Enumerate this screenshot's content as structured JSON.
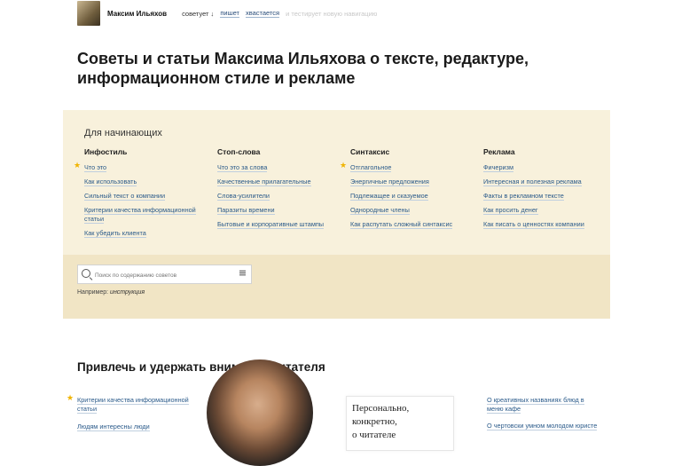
{
  "header": {
    "author": "Максим Ильяхов",
    "nav": {
      "advises": "советует ↓",
      "writes": "пишет",
      "boasts": "хвастается",
      "tests": "и тестирует новую навигацию"
    }
  },
  "page_title": "Советы и статьи Максима Ильяхова о тексте, редактуре, информационном стиле и рекламе",
  "beginners": {
    "heading": "Для начинающих",
    "columns": [
      {
        "title": "Инфостиль",
        "items": [
          {
            "label": "Что это",
            "starred": true
          },
          {
            "label": "Как использовать"
          },
          {
            "label": "Сильный текст о компании"
          },
          {
            "label": "Критерии качества информационной статьи"
          },
          {
            "label": "Как убедить клиента"
          }
        ]
      },
      {
        "title": "Стоп-слова",
        "items": [
          {
            "label": "Что это за слова"
          },
          {
            "label": "Качественные прилагательные"
          },
          {
            "label": "Слова-усилители"
          },
          {
            "label": "Паразиты времени"
          },
          {
            "label": "Бытовые и корпоративные штампы"
          }
        ]
      },
      {
        "title": "Синтаксис",
        "items": [
          {
            "label": "Отглагольное",
            "starred": true
          },
          {
            "label": "Энергичные предложения"
          },
          {
            "label": "Подлежащее и сказуемое"
          },
          {
            "label": "Однородные члены"
          },
          {
            "label": "Как распутать сложный синтаксис"
          }
        ]
      },
      {
        "title": "Реклама",
        "items": [
          {
            "label": "Фичеризм"
          },
          {
            "label": "Интересная и полезная реклама"
          },
          {
            "label": "Факты в рекламном тексте"
          },
          {
            "label": "Как просить денег"
          },
          {
            "label": "Как писать о ценностях компании"
          }
        ]
      }
    ]
  },
  "search": {
    "placeholder": "Поиск по содержанию советов",
    "example_prefix": "Например:",
    "example_value": "инструкция"
  },
  "section": {
    "title": "Привлечь и удержать внимание читателя",
    "left_items": [
      {
        "label": "Критерии качества информационной статьи",
        "starred": true
      },
      {
        "label": "Людям интересны люди"
      }
    ],
    "card_lines": [
      "Персонально,",
      "конкретно,",
      "о читателе"
    ],
    "right_items": [
      {
        "label": "О креативных названиях блюд в меню кафе"
      },
      {
        "label": "О чертовски умном молодом юристе"
      }
    ]
  },
  "colors": {
    "panel": "#f8f1dc",
    "panel_search": "#f1e5c5",
    "link": "#2a5a8a",
    "star": "#f0b400"
  }
}
